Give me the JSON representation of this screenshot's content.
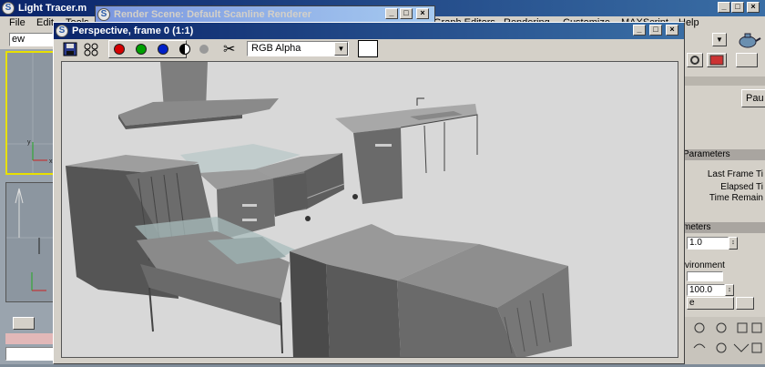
{
  "main_window": {
    "title": "Light Tracer.m",
    "menu": [
      "File",
      "Edit",
      "Tools",
      "Graph Editors",
      "Rendering",
      "Customize",
      "MAXScript",
      "Help"
    ],
    "toolbar_field": "ew"
  },
  "render_scene": {
    "title": "Render Scene: Default Scanline Renderer"
  },
  "frame_window": {
    "title": "Perspective, frame 0 (1:1)",
    "channel_select": "RGB Alpha",
    "channel_colors": {
      "red": "#d40000",
      "green": "#00a000",
      "blue": "#0020c8"
    }
  },
  "right_panel": {
    "button_label": "Pau",
    "parameters_header": "Parameters",
    "last_frame_label": "Last Frame Ti",
    "elapsed_label": "Elapsed Ti",
    "time_remain_label": "Time Remain",
    "meters_header": "meters",
    "spinner_1_value": "1.0",
    "environment_label": "vironment",
    "spinner_2_value": "100.0",
    "small_label": "e"
  },
  "colors": {
    "desktop": "#7f8c99",
    "title_active": "#0a246a",
    "render_bg": "#d8d8d8"
  }
}
